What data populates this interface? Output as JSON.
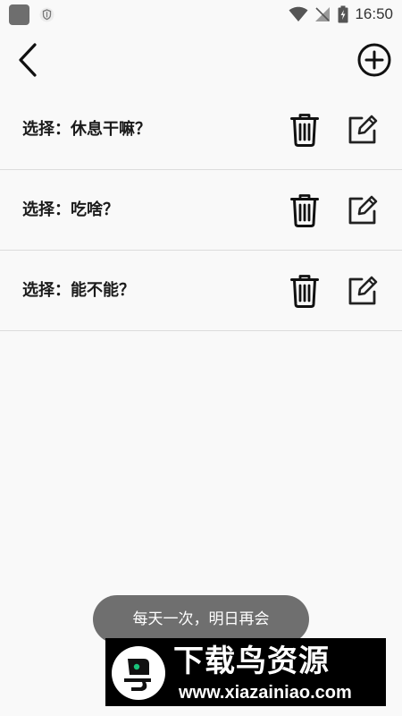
{
  "status_bar": {
    "time": "16:50"
  },
  "header": {
    "back_icon": "chevron-left-icon",
    "add_icon": "plus-circle-icon"
  },
  "items": [
    {
      "label": "选择：休息干嘛？"
    },
    {
      "label": "选择：吃啥？"
    },
    {
      "label": "选择：能不能？"
    }
  ],
  "toast": {
    "text": "每天一次，明日再会"
  },
  "watermark": {
    "title": "下载鸟资源",
    "url": "www.xiazainiao.com"
  },
  "colors": {
    "background": "#f9f9f9",
    "text": "#1b1b1b",
    "divider": "#dcdcdc",
    "toast_bg": "#6f6f6f",
    "watermark_bg": "#000000",
    "logo_green": "#19c27a"
  }
}
